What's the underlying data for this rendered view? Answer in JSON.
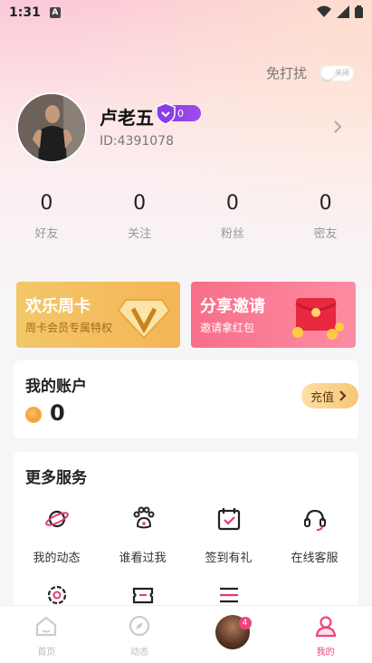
{
  "status_bar": {
    "time": "1:31",
    "app_indicator": "A"
  },
  "dnd": {
    "label": "免打扰",
    "toggle_text": "关闭",
    "enabled": false
  },
  "profile": {
    "name": "卢老五",
    "vip_level": "0",
    "user_id": "ID:4391078"
  },
  "stats": [
    {
      "value": "0",
      "label": "好友"
    },
    {
      "value": "0",
      "label": "关注"
    },
    {
      "value": "0",
      "label": "粉丝"
    },
    {
      "value": "0",
      "label": "密友"
    }
  ],
  "promos": {
    "week": {
      "title": "欢乐周卡",
      "subtitle": "周卡会员专属特权"
    },
    "share": {
      "title": "分享邀请",
      "subtitle": "邀请拿红包"
    }
  },
  "account": {
    "title": "我的账户",
    "balance": "0",
    "recharge_label": "充值"
  },
  "services": {
    "title": "更多服务",
    "items": [
      {
        "label": "我的动态",
        "icon": "planet-icon"
      },
      {
        "label": "谁看过我",
        "icon": "paw-icon"
      },
      {
        "label": "签到有礼",
        "icon": "calendar-check-icon"
      },
      {
        "label": "在线客服",
        "icon": "headset-icon"
      },
      {
        "label": "",
        "icon": "gear-icon"
      },
      {
        "label": "",
        "icon": "ticket-icon"
      },
      {
        "label": "",
        "icon": "sliders-icon"
      }
    ]
  },
  "bottom_nav": {
    "items": [
      {
        "label": "首页",
        "icon": "home-icon"
      },
      {
        "label": "动态",
        "icon": "compass-icon"
      },
      {
        "label": "",
        "icon": "avatar",
        "badge": "4"
      },
      {
        "label": "我的",
        "icon": "user-icon",
        "active": true
      }
    ]
  },
  "colors": {
    "accent": "#f0437a",
    "vip": "#8a3fe6",
    "gold": "#f4b556"
  }
}
